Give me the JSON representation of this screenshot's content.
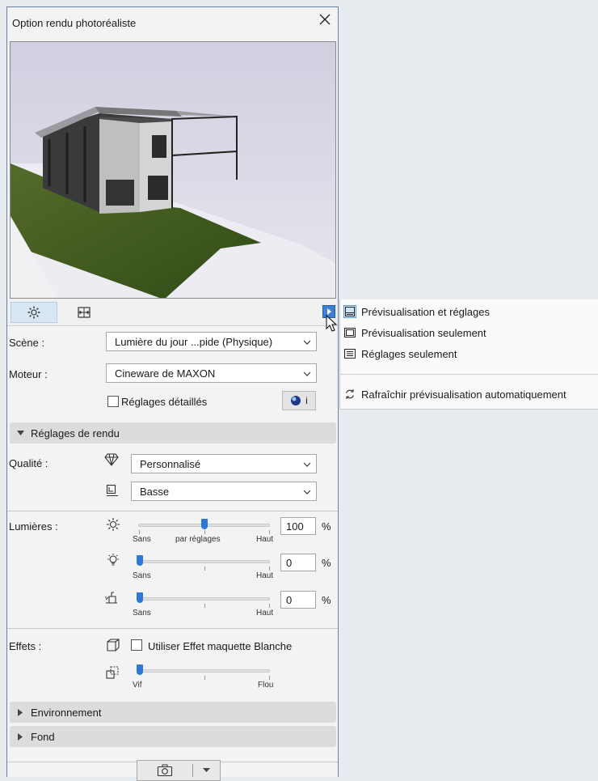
{
  "dialog": {
    "title": "Option rendu photoréaliste",
    "colors": {
      "accent": "#2b78d6",
      "panel_bg": "#f3f3f3",
      "section_bg": "#dcdcdc",
      "desktop_bg": "#e6ebf0"
    }
  },
  "tabs": {
    "settings_icon": "gear-icon",
    "size_icon": "frame-size-icon"
  },
  "scene": {
    "label": "Scène :",
    "value": "Lumière du jour ...pide (Physique)"
  },
  "engine": {
    "label": "Moteur :",
    "value": "Cineware de MAXON"
  },
  "detailed": {
    "label": "Réglages détaillés",
    "checked": false
  },
  "render_settings": {
    "header": "Réglages de rendu",
    "quality_label": "Qualité :",
    "quality_value": "Personnalisé",
    "quality_sub_value": "Basse"
  },
  "lights": {
    "label": "Lumières :",
    "sun": {
      "value": "100",
      "unit": "%",
      "min_label": "Sans",
      "mid_label": "par réglages",
      "max_label": "Haut",
      "level": 0.5
    },
    "lamp": {
      "value": "0",
      "unit": "%",
      "min_label": "Sans",
      "max_label": "Haut",
      "level": 0.0
    },
    "indirect": {
      "value": "0",
      "unit": "%",
      "min_label": "Sans",
      "max_label": "Haut",
      "level": 0.0
    }
  },
  "effects": {
    "label": "Effets :",
    "white_model_label": "Utiliser Effet maquette Blanche",
    "white_model_checked": false,
    "blur": {
      "min_label": "Vif",
      "max_label": "Flou",
      "level": 0.0
    }
  },
  "sections": {
    "environment": "Environnement",
    "background": "Fond"
  },
  "menu": {
    "items": [
      {
        "label": "Prévisualisation et réglages",
        "icon": "preview-and-settings-icon",
        "selected": true
      },
      {
        "label": "Prévisualisation seulement",
        "icon": "preview-only-icon",
        "selected": false
      },
      {
        "label": "Réglages seulement",
        "icon": "settings-only-icon",
        "selected": false
      },
      {
        "label": "Rafraîchir prévisualisation automatiquement",
        "icon": "refresh-icon",
        "selected": false
      }
    ]
  }
}
